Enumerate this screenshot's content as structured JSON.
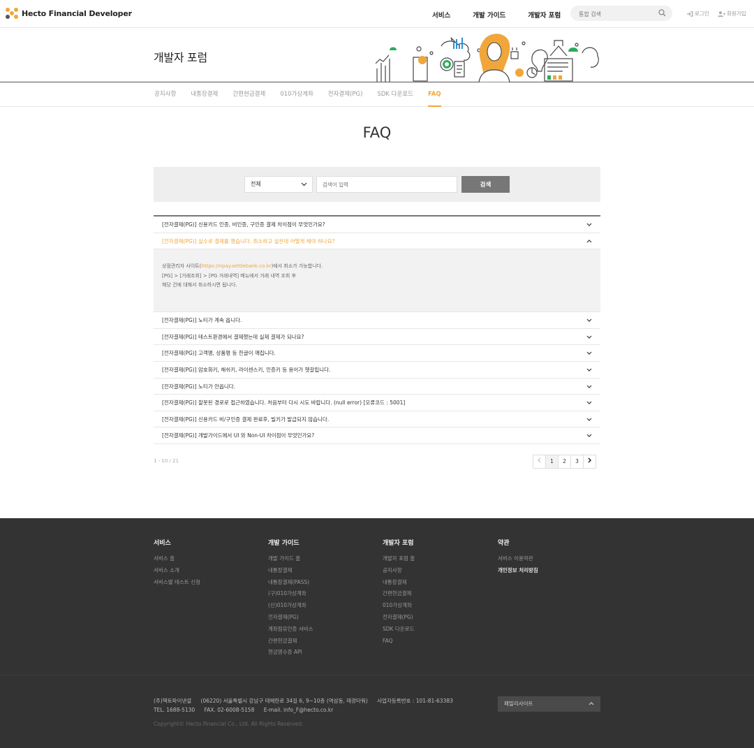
{
  "header": {
    "logo_text": "Hecto Financial Developer",
    "nav": [
      "서비스",
      "개발 가이드",
      "개발자 포럼"
    ],
    "search_placeholder": "통합 검색",
    "login": "로그인",
    "signup": "회원가입"
  },
  "hero": {
    "title": "개발자 포럼"
  },
  "subnav": {
    "items": [
      "공지사항",
      "내통장결제",
      "간편현금결제",
      "010가상계좌",
      "전자결제(PG)",
      "SDK 다운로드",
      "FAQ"
    ],
    "active": "FAQ"
  },
  "page_title": "FAQ",
  "search": {
    "select_value": "전체",
    "keyword_placeholder": "검색어 입력",
    "button": "검색"
  },
  "faq": {
    "items": [
      "[전자결제(PG)] 신용카드 인증, 비인증, 구인증 결제 차이점이 무엇인가요?",
      "[전자결제(PG)] 실수로 결제를 했습니다. 취소하고 싶은데 어떻게 해야 하나요?",
      "[전자결제(PG)] 노티가 계속 옵니다.",
      "[전자결제(PG)] 테스트환경에서 결제했는데 실제 결제가 되나요?",
      "[전자결제(PG)] 고객명, 상품명 등 한글이 깨집니다.",
      "[전자결제(PG)] 암호화키, 해쉬키, 라이센스키, 인증키 등 용어가 헷갈립니다.",
      "[전자결제(PG)] 노티가 안옵니다.",
      "[전자결제(PG)] 잘못된 경로로 접근하였습니다. 처음부터 다시 시도 바랍니다. (null error) [오류코드 : 5001]",
      "[전자결제(PG)] 신용카드 비/구인증 결제 완료후, 빌키가 발급되지 않습니다.",
      "[전자결제(PG)] 개발가이드에서 UI 와 Non-UI 차이점이 무엇인가요?"
    ],
    "open_index": 1,
    "answer": {
      "line1_prefix": "상점관리자 사이트(",
      "line1_link": "https://npay.settlebank.co.kr",
      "line1_suffix": ")에서 취소가 가능합니다.",
      "line2": "[PG] > [거래조회] > [PG 거래내역] 메뉴에서 거래 내역 조회 후",
      "line3": "해당 건에 대해서 취소하시면 됩니다."
    }
  },
  "pagination": {
    "count": "1 - 10 / 21",
    "pages": [
      "1",
      "2",
      "3"
    ],
    "current": "1"
  },
  "footer": {
    "columns": [
      {
        "title": "서비스",
        "links": [
          "서비스 홈",
          "서비스 소개",
          "서비스별 테스트 신청"
        ]
      },
      {
        "title": "개발 가이드",
        "links": [
          "개발 가이드 홈",
          "내통장결제",
          "내통장결제(PASS)",
          "(구)010가상계좌",
          "(신)010가상계좌",
          "전자결제(PG)",
          "계좌점유인증 서비스",
          "간편현금결제",
          "현금영수증 API"
        ]
      },
      {
        "title": "개발자 포럼",
        "links": [
          "개발자 포럼 홈",
          "공지사항",
          "내통장결제",
          "간편현금결제",
          "010가상계좌",
          "전자결제(PG)",
          "SDK 다운로드",
          "FAQ"
        ]
      },
      {
        "title": "약관",
        "links": [
          "서비스 이용약관",
          "개인정보 처리방침"
        ]
      }
    ],
    "company": "(주)헥토파이낸셜",
    "address": "(06220) 서울특별시 강남구 테헤란로 34길 6, 9~10층 (역삼동, 태광타워)",
    "bizno": "사업자등록번호 : 101-81-63383",
    "tel": "TEL. 1688-5130",
    "fax": "FAX. 02-6008-5158",
    "email": "E-mail. info_F@hecto.co.kr",
    "copyright": "Copyright© Hecto Financial Co., Ltd. All Rights Reserved.",
    "family_site": "패밀리사이트"
  },
  "colors": {
    "accent": "#f0a63a",
    "footer_bg": "#333333",
    "button_gray": "#777777"
  }
}
